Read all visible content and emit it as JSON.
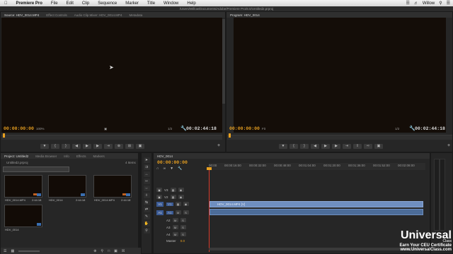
{
  "menubar": {
    "app": "Premiere Pro",
    "items": [
      "File",
      "Edit",
      "Clip",
      "Sequence",
      "Marker",
      "Title",
      "Window",
      "Help"
    ],
    "user": "Willow"
  },
  "window_title": "/Users/Willow/Documents/Adobe/Premiere Pro/8.0/Untitled2.prproj",
  "source_panel": {
    "tabs": [
      "Source: HDV_0014.MP4",
      "Effect Controls",
      "Audio Clip Mixer: HDV_0014.MP4",
      "Metadata"
    ],
    "timecode": "00:00:00:00",
    "zoom": "100%",
    "resolution": "1/2",
    "duration": "00:02:44:18"
  },
  "program_panel": {
    "tabs": [
      "Program: HDV_0014"
    ],
    "timecode": "00:00:00:00",
    "zoom": "Fit",
    "resolution": "1/2",
    "duration": "00:02:44:18"
  },
  "project_panel": {
    "tabs": [
      "Project: Untitled2",
      "Media Browser",
      "Info",
      "Effects",
      "Markers"
    ],
    "file": "Untitled2.prproj",
    "count": "4 Items",
    "clips": [
      {
        "name": "HDV_0014.MP4",
        "duration": "2:44:18"
      },
      {
        "name": "HDV_0014",
        "duration": "2:44:18"
      },
      {
        "name": "HDV_0014.MP4",
        "duration": "2:44:18"
      },
      {
        "name": "HDV_0014",
        "duration": ""
      }
    ]
  },
  "timeline": {
    "tab": "HDV_0014",
    "timecode": "00:00:00:00",
    "ruler": [
      "00:00",
      "00:00:16:00",
      "00:00:32:00",
      "00:00:48:00",
      "00:01:04:00",
      "00:01:20:00",
      "00:01:36:00",
      "00:01:52:00",
      "00:02:08:00"
    ],
    "video_tracks": [
      "V3",
      "V2",
      "V1"
    ],
    "audio_tracks": [
      "A1",
      "A2",
      "A3",
      "A4"
    ],
    "source_patch_v": "V1",
    "source_patch_a": "A1",
    "master_label": "Master",
    "master_value": "0.0",
    "clip_video": "HDV_0014.MP4 [V]",
    "clip_audio": ""
  },
  "watermark": {
    "brand_a": "Uni",
    "brand_b": "versal",
    "sub": "Class",
    "line1": "Earn Your CEU Certificate",
    "line2": "www.UniversalClass.com"
  },
  "colors": {
    "timecode_orange": "#e8a020",
    "clip_blue": "#6f8fc0",
    "playhead_red": "#d83a2a"
  }
}
